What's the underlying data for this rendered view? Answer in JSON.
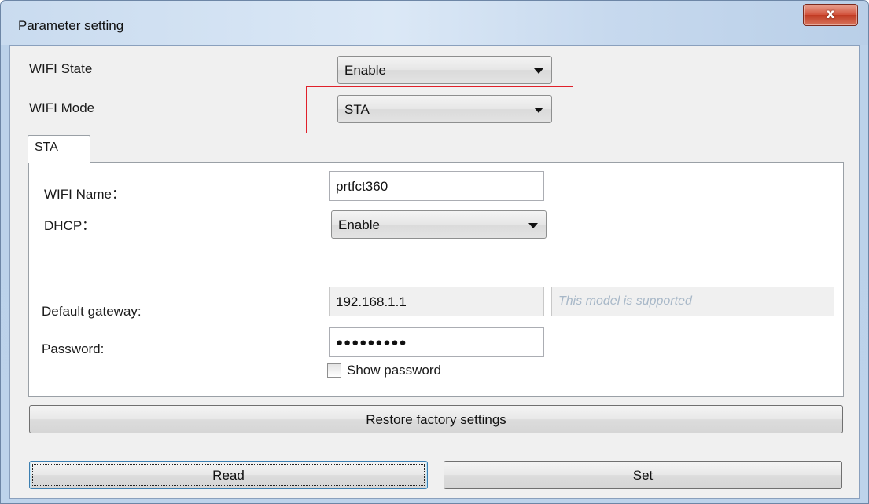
{
  "window": {
    "title": "Parameter setting",
    "close_glyph": "x"
  },
  "wifi_state": {
    "label": "WIFI State",
    "value": "Enable"
  },
  "wifi_mode": {
    "label": "WIFI Mode",
    "value": "STA",
    "highlight_color": "#e0202a"
  },
  "tabs": [
    {
      "label": "STA",
      "selected": true
    }
  ],
  "sta": {
    "wifi_name": {
      "label": "WIFI Name：",
      "value": "prtfct360"
    },
    "dhcp": {
      "label": "DHCP：",
      "value": "Enable"
    },
    "default_gateway": {
      "label": "Default gateway:",
      "value": "192.168.1.1",
      "note": "This model is supported"
    },
    "password": {
      "label": "Password:",
      "value": "●●●●●●●●●"
    },
    "show_password": {
      "label": "Show password",
      "checked": false
    }
  },
  "buttons": {
    "restore": "Restore factory settings",
    "read": "Read",
    "set": "Set"
  },
  "colors": {
    "title_bar": "#c9dbef",
    "client_bg": "#f0f0f0",
    "close_button": "#c03a22"
  }
}
